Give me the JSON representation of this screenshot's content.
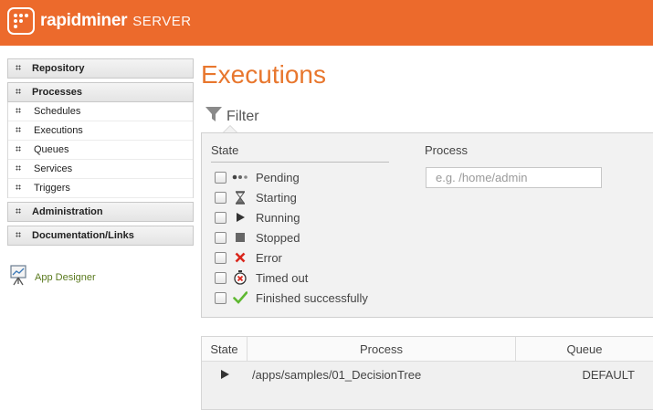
{
  "header": {
    "brand_name": "rapidminer",
    "brand_suffix": "SERVER",
    "accent_color": "#ec6a2c"
  },
  "sidebar": {
    "sections": [
      {
        "label": "Repository"
      },
      {
        "label": "Processes",
        "subitems": [
          {
            "label": "Schedules"
          },
          {
            "label": "Executions"
          },
          {
            "label": "Queues"
          },
          {
            "label": "Services"
          },
          {
            "label": "Triggers"
          }
        ]
      },
      {
        "label": "Administration"
      },
      {
        "label": "Documentation/Links"
      }
    ],
    "app_designer_label": "App Designer"
  },
  "main": {
    "title": "Executions",
    "filter_label": "Filter",
    "filter": {
      "state_heading": "State",
      "process_heading": "Process",
      "process_placeholder": "e.g. /home/admin",
      "states": [
        {
          "label": "Pending",
          "icon": "ellipsis-icon",
          "checked": false
        },
        {
          "label": "Starting",
          "icon": "hourglass-icon",
          "checked": false
        },
        {
          "label": "Running",
          "icon": "play-icon",
          "checked": false
        },
        {
          "label": "Stopped",
          "icon": "stop-icon",
          "checked": false
        },
        {
          "label": "Error",
          "icon": "cross-icon",
          "checked": false
        },
        {
          "label": "Timed out",
          "icon": "timeout-icon",
          "checked": false
        },
        {
          "label": "Finished successfully",
          "icon": "checkmark-icon",
          "checked": false
        }
      ]
    },
    "table": {
      "headers": {
        "state": "State",
        "process": "Process",
        "queue": "Queue"
      },
      "rows": [
        {
          "state_icon": "play-icon",
          "process": "/apps/samples/01_DecisionTree",
          "queue": "DEFAULT"
        }
      ]
    }
  }
}
